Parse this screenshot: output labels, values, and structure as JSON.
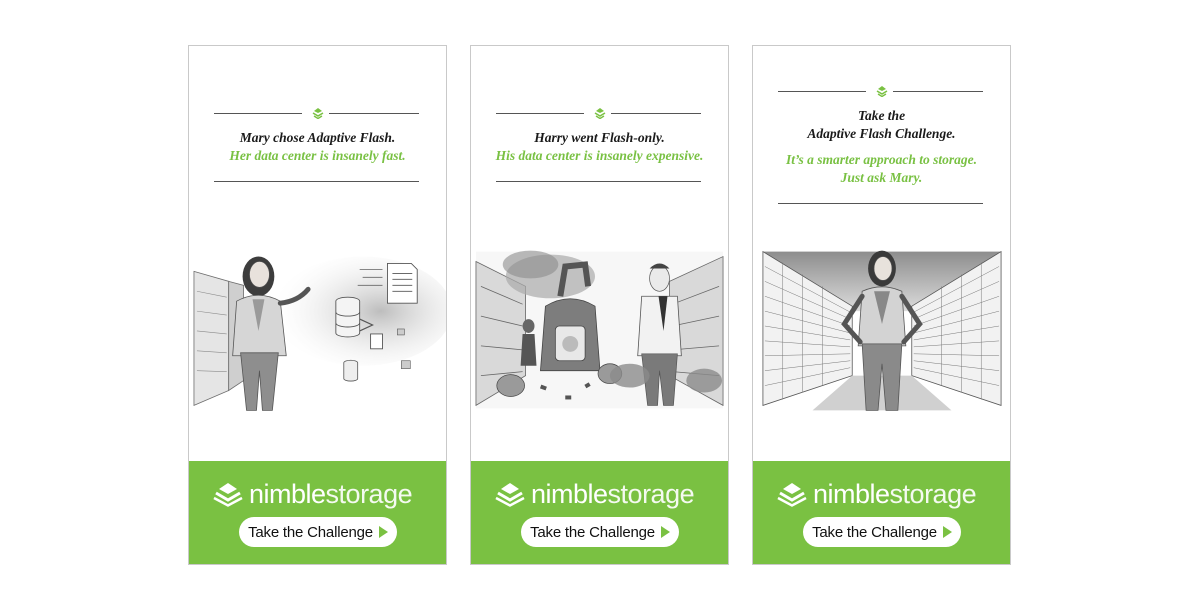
{
  "colors": {
    "brand_green": "#7ac142",
    "headline_dark": "#1a1a1a",
    "headline_green": "#79c143"
  },
  "ads": [
    {
      "headline_dark": [
        "Mary chose Adaptive Flash."
      ],
      "headline_green": [
        "Her data center is insanely fast."
      ],
      "illustration": "mary-data-center-fast",
      "brand": {
        "name_part1": "nimble",
        "name_part2": "storage"
      },
      "cta_label": "Take the Challenge",
      "icons": {
        "logo": "nimble-logo-icon",
        "cta": "play-arrow-icon",
        "divider": "leaf-mark-icon"
      }
    },
    {
      "headline_dark": [
        "Harry went Flash-only."
      ],
      "headline_green": [
        "His data center is insanely expensive."
      ],
      "illustration": "harry-data-center-expensive",
      "brand": {
        "name_part1": "nimble",
        "name_part2": "storage"
      },
      "cta_label": "Take the Challenge",
      "icons": {
        "logo": "nimble-logo-icon",
        "cta": "play-arrow-icon",
        "divider": "leaf-mark-icon"
      }
    },
    {
      "headline_dark": [
        "Take the",
        "Adaptive Flash Challenge."
      ],
      "headline_green": [
        "It’s a smarter approach to storage.",
        "Just ask Mary."
      ],
      "illustration": "mary-server-aisle",
      "brand": {
        "name_part1": "nimble",
        "name_part2": "storage"
      },
      "cta_label": "Take the Challenge",
      "icons": {
        "logo": "nimble-logo-icon",
        "cta": "play-arrow-icon",
        "divider": "leaf-mark-icon"
      }
    }
  ]
}
